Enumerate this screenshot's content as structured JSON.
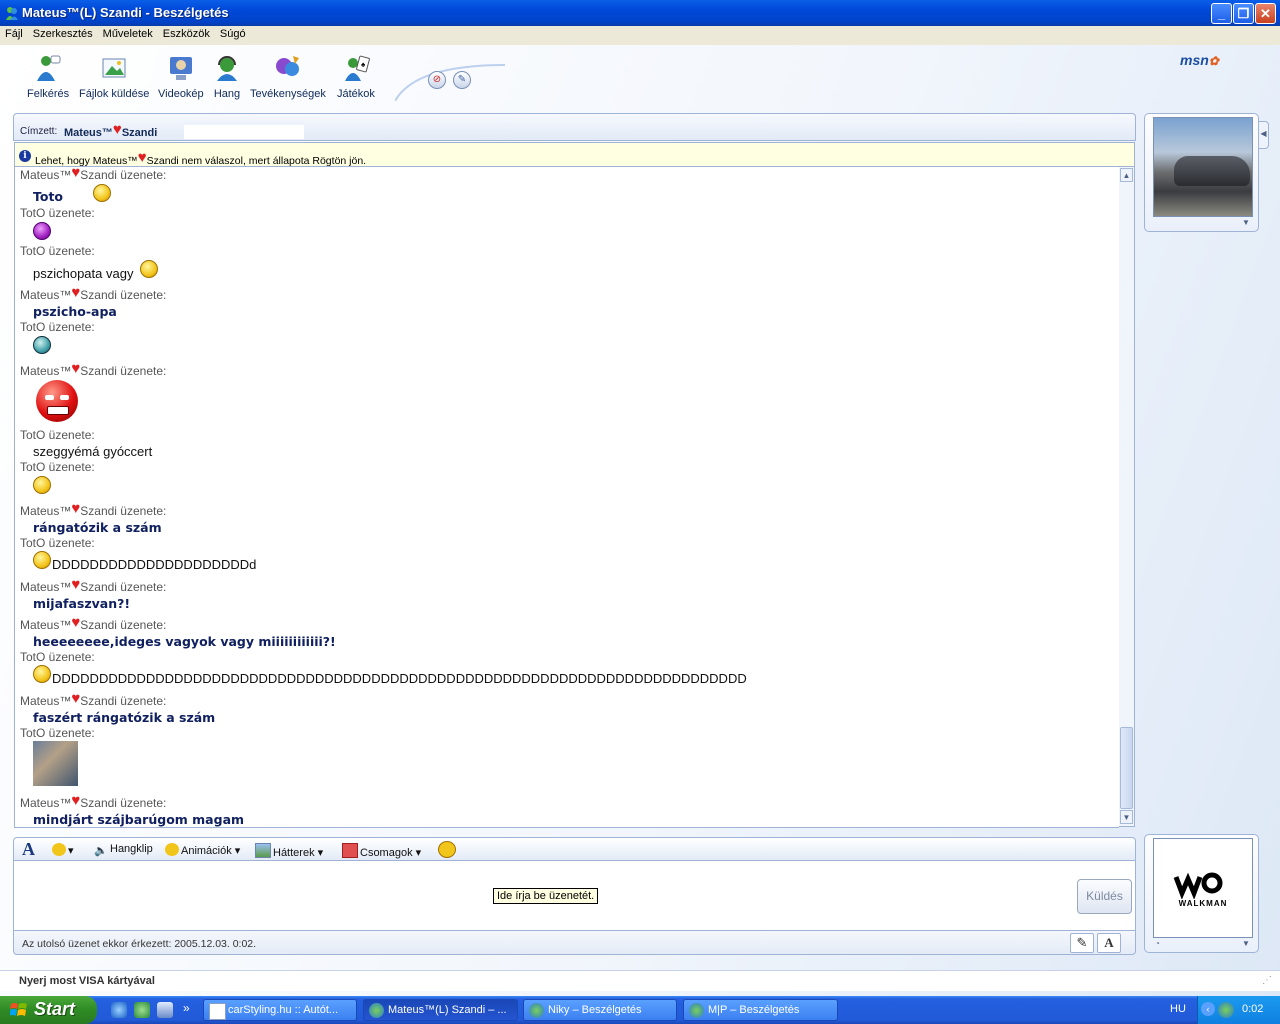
{
  "window": {
    "title": "Mateus™(L) Szandi - Beszélgetés"
  },
  "menu": [
    "Fájl",
    "Szerkesztés",
    "Műveletek",
    "Eszközök",
    "Súgó"
  ],
  "toolbar": {
    "invite": "Felkérés",
    "send_files": "Fájlok küldése",
    "video": "Videokép",
    "voice": "Hang",
    "activities": "Tevékenységek",
    "games": "Játékok",
    "logo": "msn"
  },
  "to": {
    "label": "Címzett:",
    "name_a": "Mateus™",
    "name_b": "Szandi"
  },
  "warning": {
    "part1": "Lehet, hogy Mateus™",
    "part2": "Szandi nem válaszol, mert állapota Rögtön jön."
  },
  "senders": {
    "mateus_a": "Mateus™",
    "mateus_b": "Szandi üzenete:",
    "toto": "TotO üzenete:"
  },
  "messages": {
    "m1": "Toto",
    "m3": "pszichopata vagy",
    "m4": "pszicho-apa",
    "m7": "szeggyémá gyóccert",
    "m9": "rángatózik a szám",
    "m10": "DDDDDDDDDDDDDDDDDDDDDd",
    "m11": "mijafaszvan?!",
    "m12": "heeeeeeee,ideges vagyok vagy miiiiiiiiiiii?!",
    "m13": "DDDDDDDDDDDDDDDDDDDDDDDDDDDDDDDDDDDDDDDDDDDDDDDDDDDDDDDDDDDDDDDDDDDDDDDDDD",
    "m14": "faszért rángatózik a szám",
    "m16": "mindjárt szájbarúgom magam"
  },
  "formatbar": {
    "font": "A",
    "voice_clip": "Hangklip",
    "animations": "Animációk",
    "backgrounds": "Hátterek",
    "packs": "Csomagok"
  },
  "input": {
    "tooltip": "Ide írja be üzenetét.",
    "send": "Küldés"
  },
  "status": {
    "last_message": "Az utolsó üzenet ekkor érkezett: 2005.12.03. 0:02."
  },
  "ad": {
    "panel_brand": "WALKMAN",
    "bottom": "Nyerj most VISA kártyával"
  },
  "taskbar": {
    "start": "Start",
    "tasks": [
      {
        "label": "carStyling.hu :: Autót...",
        "active": false
      },
      {
        "label": "Mateus™(L) Szandi – ...",
        "active": true
      },
      {
        "label": "Niky – Beszélgetés",
        "active": false
      },
      {
        "label": "M|P – Beszélgetés",
        "active": false
      }
    ],
    "lang": "HU",
    "clock": "0:02",
    "more": "»"
  },
  "colors": {
    "heart": "#e02020",
    "bold_text": "#102060",
    "title_bar": "#0048d8",
    "taskbar": "#225ad8",
    "start_green": "#2e8b24"
  }
}
